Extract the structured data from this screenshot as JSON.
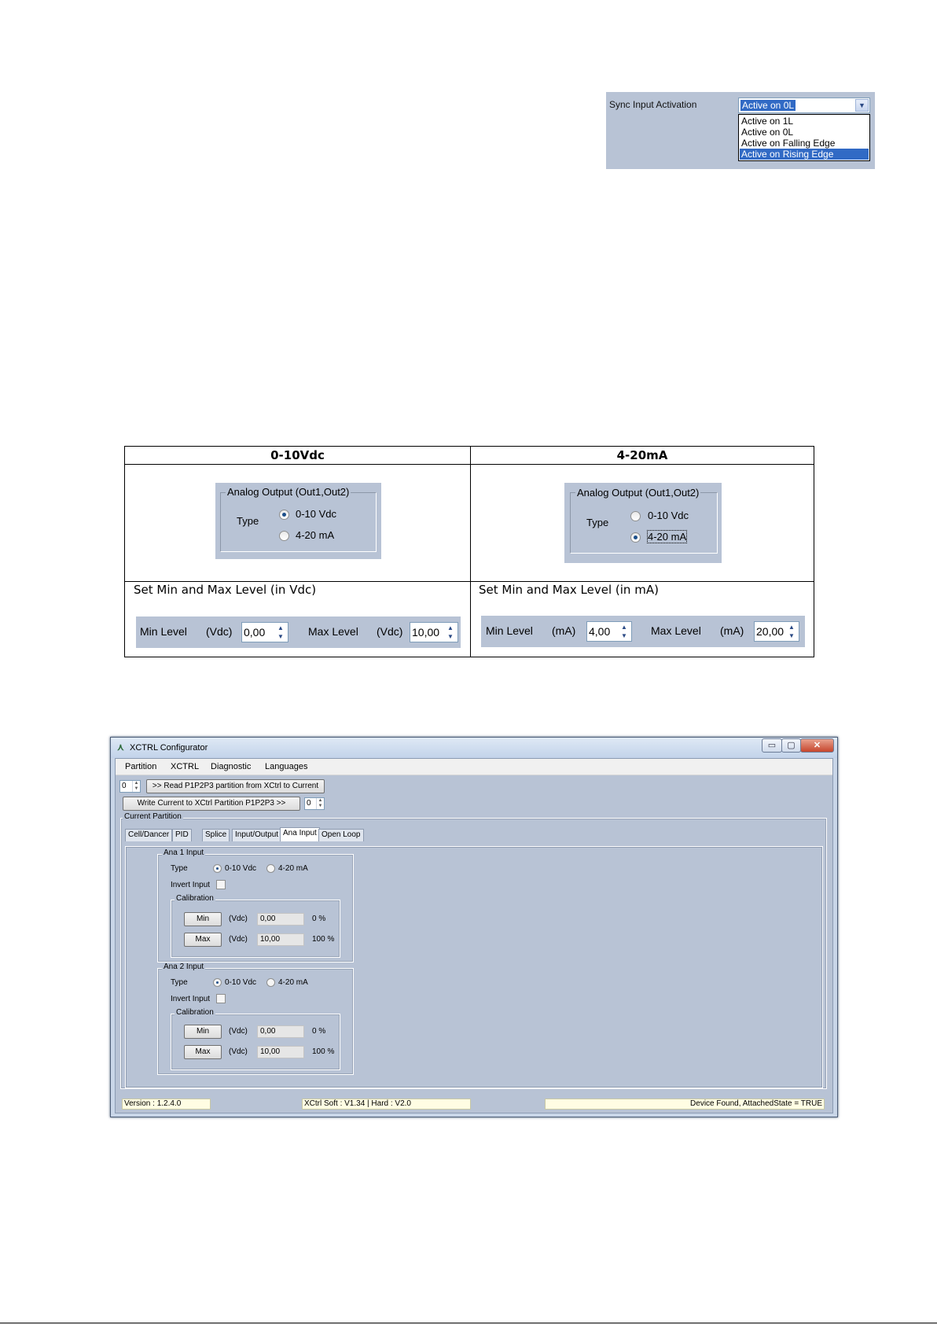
{
  "sync": {
    "label": "Sync Input Activation",
    "selected": "Active on 0L",
    "options": [
      "Active on 1L",
      "Active on 0L",
      "Active on Falling Edge",
      "Active on Rising Edge"
    ],
    "dropdown_icon": "chevron-down-icon"
  },
  "table": {
    "headers": [
      "0-10Vdc",
      "4-20mA"
    ],
    "analog_output": {
      "legend": "Analog Output   (Out1,Out2)",
      "type_label": "Type",
      "options": [
        "0-10 Vdc",
        "4-20 mA"
      ]
    },
    "vdc": {
      "set_text": "Set Min and Max Level (in Vdc)",
      "min_label": "Min Level",
      "max_label": "Max Level",
      "unit": "(Vdc)",
      "min_value": "0,00",
      "max_value": "10,00"
    },
    "ma": {
      "set_text": "Set Min and Max Level (in mA)",
      "min_label": "Min Level",
      "max_label": "Max Level",
      "unit": "(mA)",
      "min_value": "4,00",
      "max_value": "20,00"
    }
  },
  "app": {
    "title": "XCTRL Configurator",
    "menu": [
      "Partition",
      "XCTRL",
      "Diagnostic",
      "Languages"
    ],
    "read_button": ">> Read P1P2P3 partition from XCtrl to Current",
    "read_index": "0",
    "write_button": "Write Current to XCtrl Partition P1P2P3 >>",
    "write_index": "0",
    "current_partition_label": "Current Partition",
    "tabs": [
      "Cell/Dancer",
      "PID",
      "Splice",
      "Input/Output",
      "Ana Input",
      "Open Loop"
    ],
    "active_tab": "Ana Input",
    "ana_inputs": [
      {
        "legend": "Ana 1 Input",
        "type_label": "Type",
        "type_options": [
          "0-10 Vdc",
          "4-20 mA"
        ],
        "invert_label": "Invert Input",
        "calibration_label": "Calibration",
        "min_button": "Min",
        "max_button": "Max",
        "unit": "(Vdc)",
        "min_value": "0,00",
        "max_value": "10,00",
        "min_pct": "0 %",
        "max_pct": "100 %"
      },
      {
        "legend": "Ana 2 Input",
        "type_label": "Type",
        "type_options": [
          "0-10 Vdc",
          "4-20 mA"
        ],
        "invert_label": "Invert Input",
        "calibration_label": "Calibration",
        "min_button": "Min",
        "max_button": "Max",
        "unit": "(Vdc)",
        "min_value": "0,00",
        "max_value": "10,00",
        "min_pct": "0 %",
        "max_pct": "100 %"
      }
    ],
    "status": {
      "version": "Version : 1.2.4.0",
      "firmware": "XCtrl Soft : V1.34  |  Hard : V2.0",
      "device": "Device Found, AttachedState = TRUE"
    }
  },
  "colors": {
    "panel_bg": "#b8c3d5",
    "selection": "#316ac5"
  }
}
